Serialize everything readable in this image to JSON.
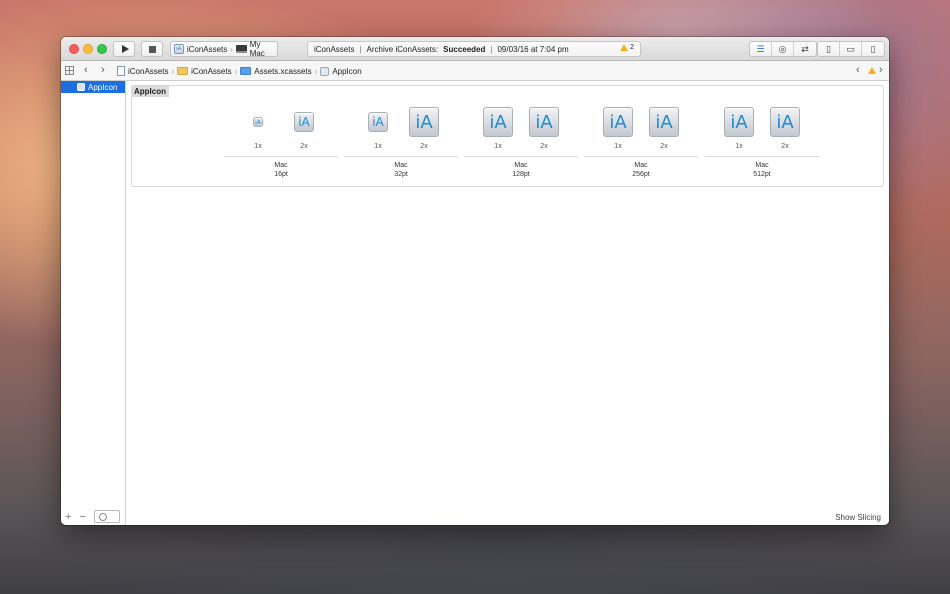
{
  "toolbar": {
    "scheme_target": "iConAssets",
    "scheme_device": "My Mac",
    "activity_project": "iConAssets",
    "activity_task": "Archive iConAssets:",
    "activity_status": "Succeeded",
    "activity_time": "09/03/16 at 7:04 pm",
    "warning_count": "2",
    "activity_separator": "|"
  },
  "jumpbar": {
    "crumbs": [
      "iConAssets",
      "iConAssets",
      "Assets.xcassets",
      "AppIcon"
    ]
  },
  "sidebar": {
    "items": [
      {
        "label": "AppIcon",
        "selected": true
      }
    ]
  },
  "editor": {
    "set_name": "AppIcon",
    "groups": [
      {
        "idiom": "Mac",
        "size": "16pt",
        "slots": [
          "1x",
          "2x"
        ]
      },
      {
        "idiom": "Mac",
        "size": "32pt",
        "slots": [
          "1x",
          "2x"
        ]
      },
      {
        "idiom": "Mac",
        "size": "128pt",
        "slots": [
          "1x",
          "2x"
        ]
      },
      {
        "idiom": "Mac",
        "size": "256pt",
        "slots": [
          "1x",
          "2x"
        ]
      },
      {
        "idiom": "Mac",
        "size": "512pt",
        "slots": [
          "1x",
          "2x"
        ]
      }
    ],
    "icon_glyph": "iA",
    "show_slicing": "Show Slicing"
  },
  "colors": {
    "accent": "#1b6fe0",
    "icon_text": "#1e8bd3",
    "warning": "#f2b21a"
  }
}
